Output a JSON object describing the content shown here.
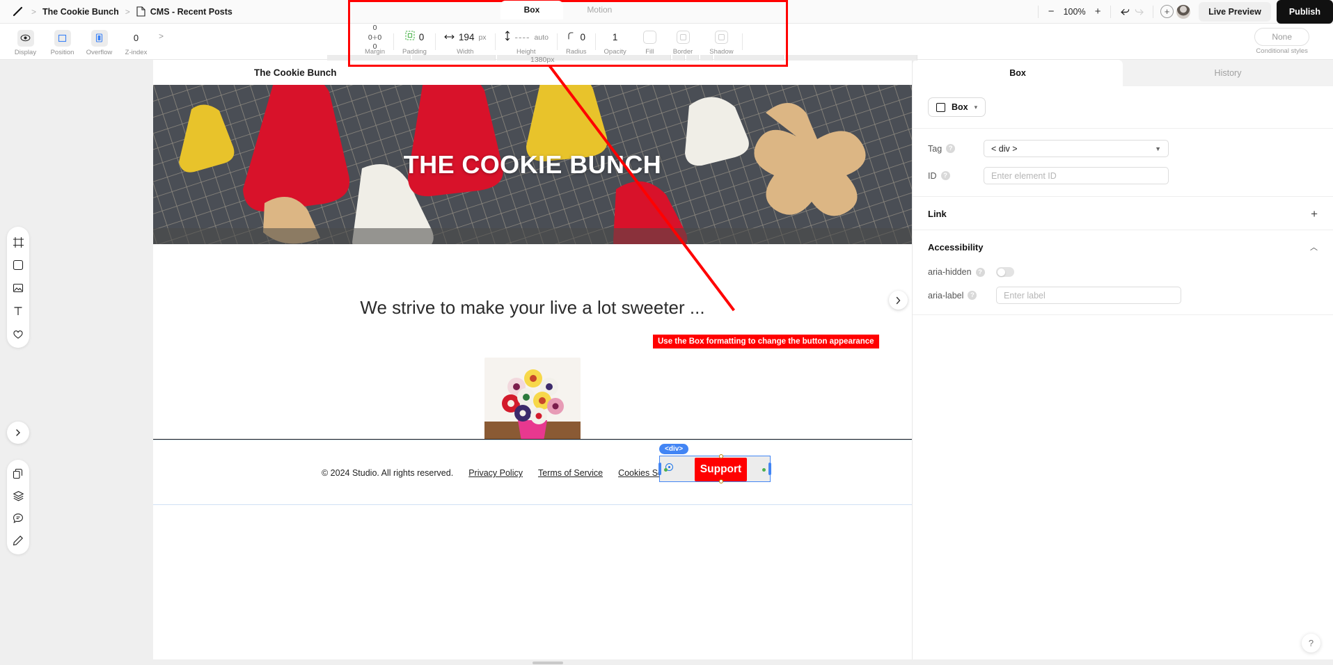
{
  "topbar": {
    "logo_icon": "pen-logo-icon",
    "breadcrumb": {
      "site": "The Cookie Bunch",
      "page": "CMS - Recent Posts",
      "separator": ">"
    },
    "zoom": {
      "minus": "−",
      "value": "100%",
      "plus": "+"
    },
    "undo_icon": "undo-icon",
    "redo_icon": "redo-icon",
    "add_icon": "+",
    "avatar_label": "user-avatar",
    "live_preview": "Live Preview",
    "publish": "Publish"
  },
  "propbar": {
    "left_items": [
      {
        "label": "Display",
        "icon": "eye-icon",
        "value": ""
      },
      {
        "label": "Position",
        "icon": "position-icon",
        "value": ""
      },
      {
        "label": "Overflow",
        "icon": "overflow-icon",
        "value": ""
      },
      {
        "label": "Z-index",
        "icon": "",
        "value": "0"
      }
    ],
    "expand_chevron": ">",
    "tabs": [
      {
        "label": "Box",
        "active": true
      },
      {
        "label": "Motion",
        "active": false
      }
    ],
    "box_fields": [
      {
        "label": "Margin",
        "top": "0",
        "right": "0",
        "bottom": "0",
        "left": "0",
        "icon": "margin-cross-icon"
      },
      {
        "label": "Padding",
        "value": "0",
        "icon": "padding-icon"
      },
      {
        "label": "Width",
        "value": "194",
        "unit": "px",
        "icon": "width-arrow-icon"
      },
      {
        "label": "Height",
        "value": "----",
        "unit": "auto",
        "icon": "height-arrow-icon"
      },
      {
        "label": "Radius",
        "value": "0",
        "icon": "radius-icon"
      },
      {
        "label": "Opacity",
        "value": "1",
        "icon": ""
      },
      {
        "label": "Fill",
        "value": "",
        "icon": "fill-swatch-icon"
      },
      {
        "label": "Border",
        "value": "",
        "icon": "border-swatch-icon"
      },
      {
        "label": "Shadow",
        "value": "",
        "icon": "shadow-swatch-icon"
      }
    ],
    "conditional": {
      "value": "None",
      "label": "Conditional styles"
    }
  },
  "left_rail": {
    "group_a": [
      "frame-icon",
      "box-icon",
      "image-icon",
      "text-icon",
      "heart-icon"
    ],
    "expand_icon": "chevron-right-icon",
    "group_b": [
      "pages-copy-icon",
      "layers-icon",
      "comment-icon",
      "pencil-icon"
    ]
  },
  "canvas": {
    "width_label": "1380px",
    "site_title": "The Cookie Bunch",
    "hero_title": "THE COOKIE BUNCH",
    "tagline": "We strive to make your live a lot sweeter ...",
    "next_arrow_icon": "chevron-right-icon",
    "mini_tools": [
      "align-icon",
      "move-down-icon"
    ],
    "footer": {
      "copyright": "© 2024 Studio. All rights reserved.",
      "links": [
        "Privacy Policy",
        "Terms of Service",
        "Cookies Settings"
      ]
    },
    "selection": {
      "tag_badge": "<div>",
      "button_label": "Support",
      "button_color": "#ff0000",
      "outline_color": "#4285f4"
    }
  },
  "annotation": {
    "callout_text": "Use the Box formatting to change the button appearance",
    "color": "#ff0000"
  },
  "right_panel": {
    "tabs": [
      {
        "label": "Box",
        "active": true
      },
      {
        "label": "History",
        "active": false
      }
    ],
    "element_selector": "Box",
    "tag": {
      "label": "Tag",
      "value": "< div >"
    },
    "id": {
      "label": "ID",
      "placeholder": "Enter element ID"
    },
    "link": {
      "title": "Link",
      "add_icon": "+"
    },
    "accessibility": {
      "title": "Accessibility",
      "collapse_icon": "chevron-up-icon",
      "aria_hidden": {
        "label": "aria-hidden",
        "enabled": false
      },
      "aria_label": {
        "label": "aria-label",
        "placeholder": "Enter label"
      }
    },
    "help_icon": "?"
  }
}
